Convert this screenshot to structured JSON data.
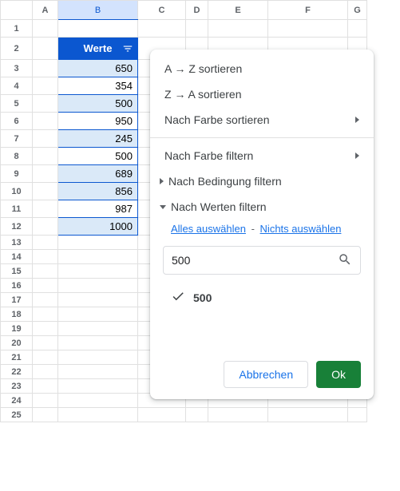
{
  "columns": [
    "A",
    "B",
    "C",
    "D",
    "E",
    "F",
    "G"
  ],
  "activeColumn": "B",
  "rowCount": 25,
  "header": {
    "label": "Werte"
  },
  "values": [
    "650",
    "354",
    "500",
    "950",
    "245",
    "500",
    "689",
    "856",
    "987",
    "1000"
  ],
  "banding": [
    true,
    false,
    true,
    false,
    true,
    false,
    true,
    true,
    false,
    true
  ],
  "menu": {
    "sortAZ": "A → Z sortieren",
    "sortZA": "Z → A sortieren",
    "sortByColor": "Nach Farbe sortieren",
    "filterByColor": "Nach Farbe filtern",
    "filterByCondition": "Nach Bedingung filtern",
    "filterByValues": "Nach Werten filtern",
    "selectAll": "Alles auswählen",
    "selectNone": "Nichts auswählen",
    "searchValue": "500",
    "matched": "500",
    "cancel": "Abbrechen",
    "ok": "Ok"
  }
}
